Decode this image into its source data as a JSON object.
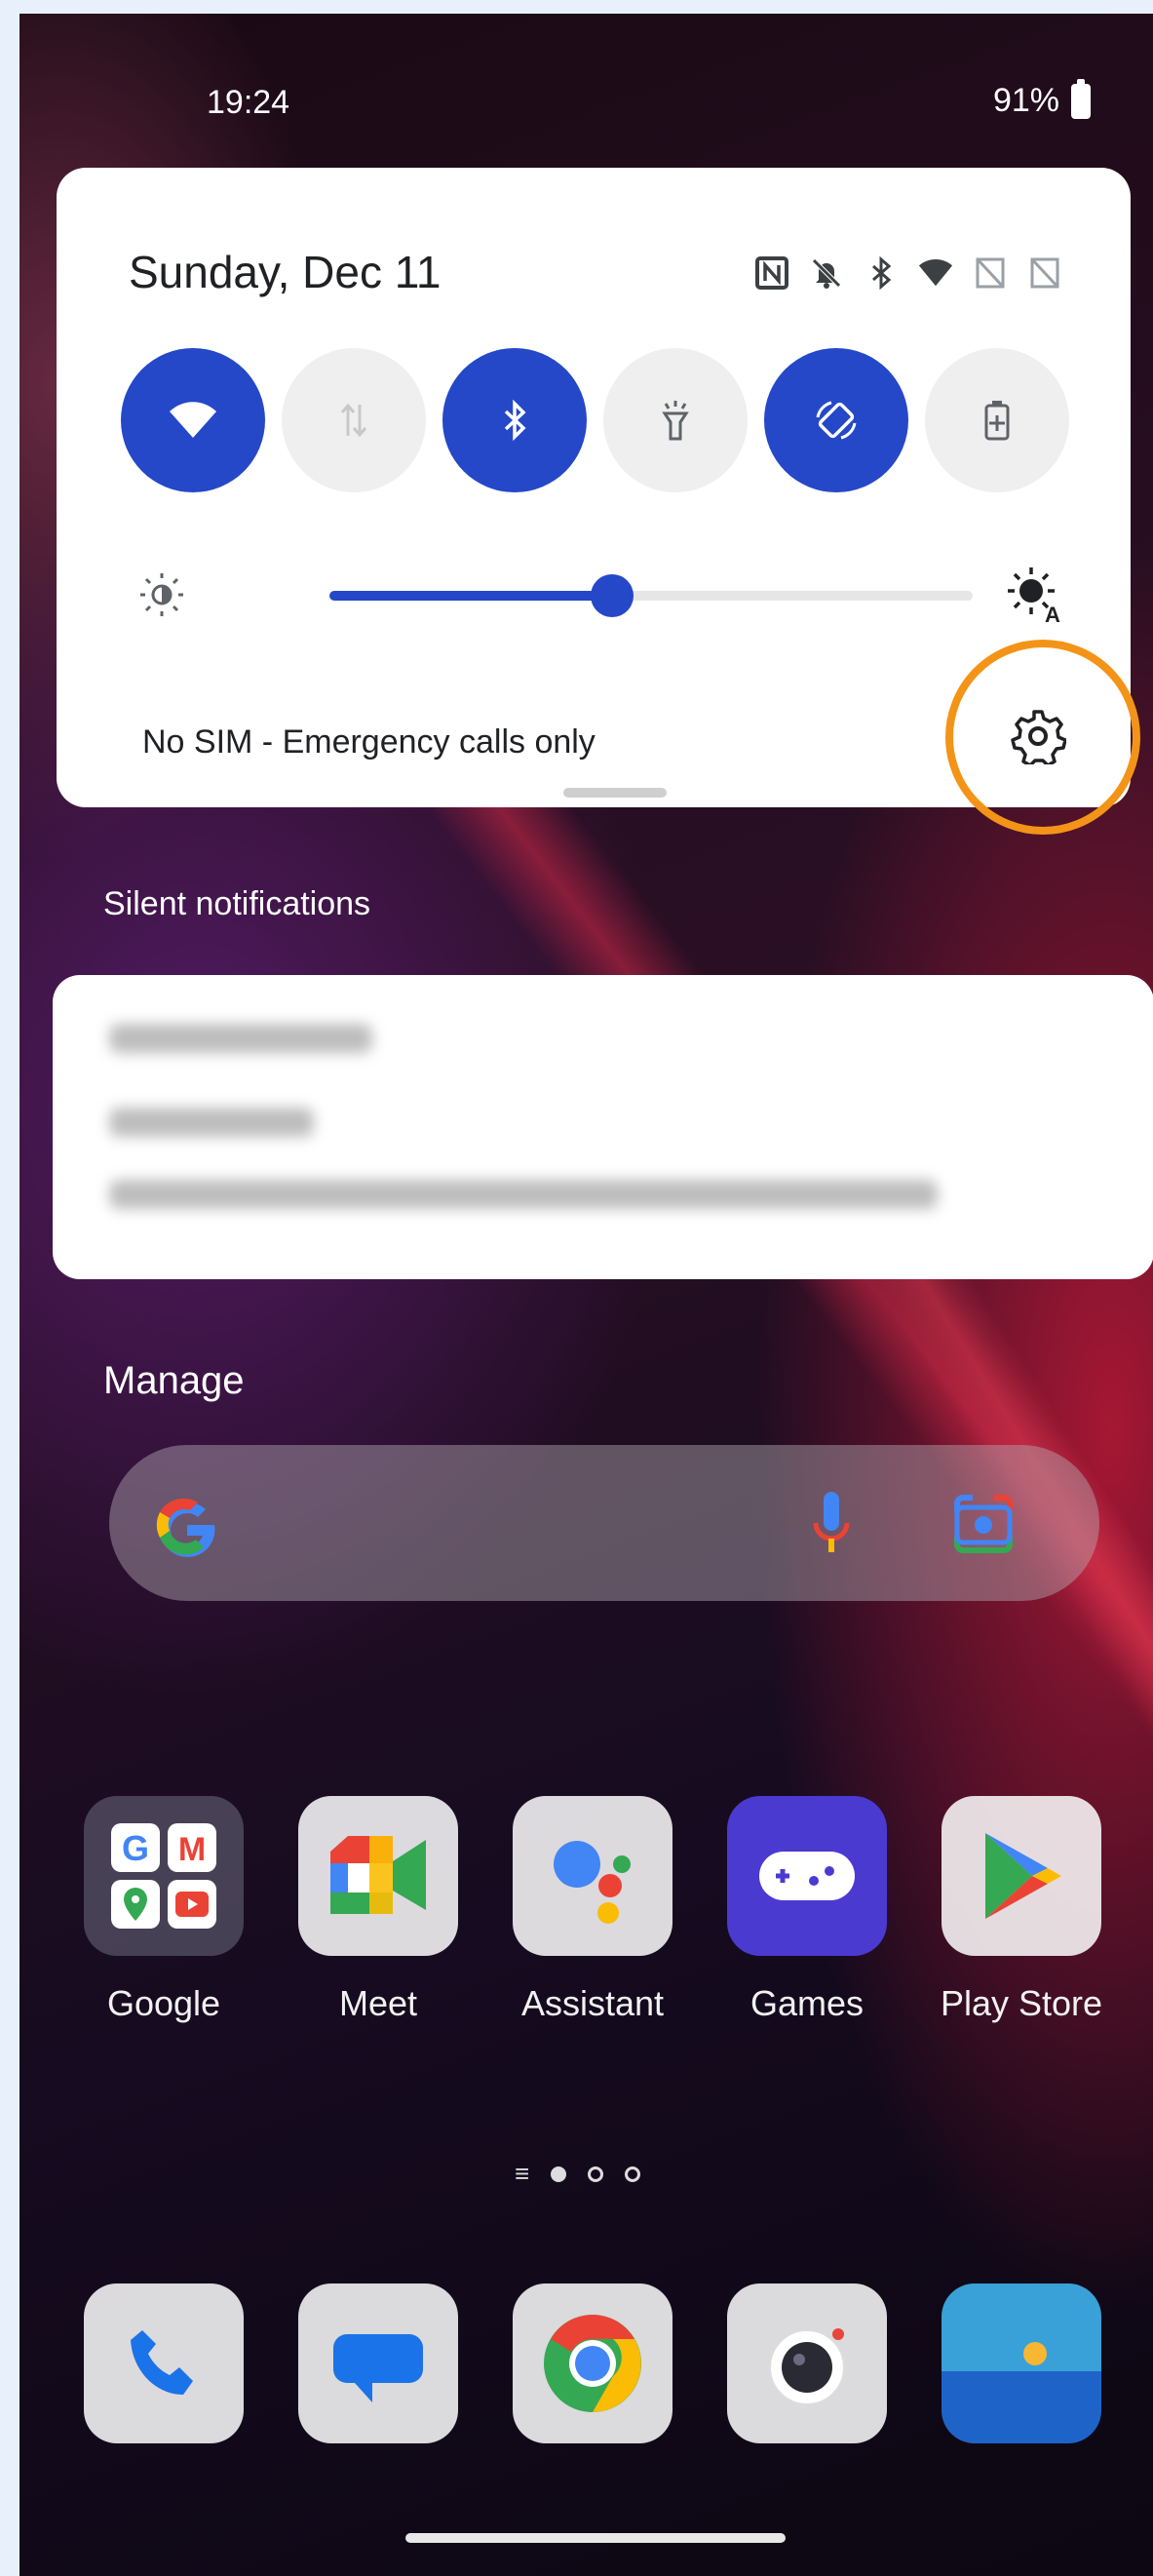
{
  "status_bar": {
    "time": "19:24",
    "battery": "91%"
  },
  "quick_settings": {
    "date": "Sunday, Dec 11",
    "tiles": [
      {
        "icon": "wifi-icon",
        "state": "on"
      },
      {
        "icon": "mobile-data-icon",
        "state": "off"
      },
      {
        "icon": "bluetooth-icon",
        "state": "on"
      },
      {
        "icon": "flashlight-icon",
        "state": "off"
      },
      {
        "icon": "auto-rotate-icon",
        "state": "on"
      },
      {
        "icon": "battery-saver-icon",
        "state": "off"
      }
    ],
    "brightness_level": 0.44,
    "sim_status": "No SIM - Emergency calls only",
    "accent_color": "#2448c8",
    "highlight_color": "#f39418"
  },
  "notifications": {
    "section_title": "Silent notifications"
  },
  "manage_label": "Manage",
  "search": {
    "logo": "google-g-icon"
  },
  "apps": [
    {
      "label": "Google"
    },
    {
      "label": "Meet"
    },
    {
      "label": "Assistant"
    },
    {
      "label": "Games"
    },
    {
      "label": "Play Store"
    }
  ],
  "dock": [
    "phone-icon",
    "messages-icon",
    "chrome-icon",
    "camera-icon",
    "gallery-icon"
  ]
}
